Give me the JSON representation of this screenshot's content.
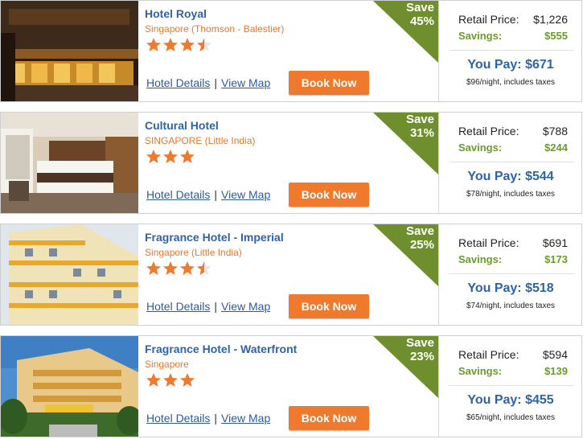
{
  "colors": {
    "accent_orange": "#ef7a2e",
    "badge_green": "#6f8f2e",
    "link_blue": "#2f63a8",
    "savings_green": "#6d9a2d"
  },
  "links": {
    "details": "Hotel Details",
    "separator": "|",
    "map": "View Map"
  },
  "button": {
    "book": "Book Now"
  },
  "labels": {
    "save": "Save",
    "retail": "Retail Price:",
    "savings": "Savings:",
    "you_pay_prefix": "You Pay: "
  },
  "hotels": [
    {
      "name": "Hotel Royal",
      "location": "Singapore (Thomson - Balestier)",
      "rating": 3.5,
      "save_pct": "45%",
      "retail": "$1,226",
      "savings": "$555",
      "you_pay": "You Pay: $671",
      "per_night": "$96/night, includes taxes",
      "photo_icon": "hotel-night-photo"
    },
    {
      "name": "Cultural Hotel",
      "location": "SINGAPORE (Little India)",
      "rating": 3,
      "save_pct": "31%",
      "retail": "$788",
      "savings": "$244",
      "you_pay": "You Pay: $544",
      "per_night": "$78/night, includes taxes",
      "photo_icon": "hotel-room-photo"
    },
    {
      "name": "Fragrance Hotel - Imperial",
      "location": "Singapore (Little India)",
      "rating": 3.5,
      "save_pct": "25%",
      "retail": "$691",
      "savings": "$173",
      "you_pay": "You Pay: $518",
      "per_night": "$74/night, includes taxes",
      "photo_icon": "hotel-building-photo"
    },
    {
      "name": "Fragrance Hotel - Waterfront",
      "location": "Singapore",
      "rating": 3,
      "save_pct": "23%",
      "retail": "$594",
      "savings": "$139",
      "you_pay": "You Pay: $455",
      "per_night": "$65/night, includes taxes",
      "photo_icon": "hotel-exterior-photo"
    }
  ]
}
